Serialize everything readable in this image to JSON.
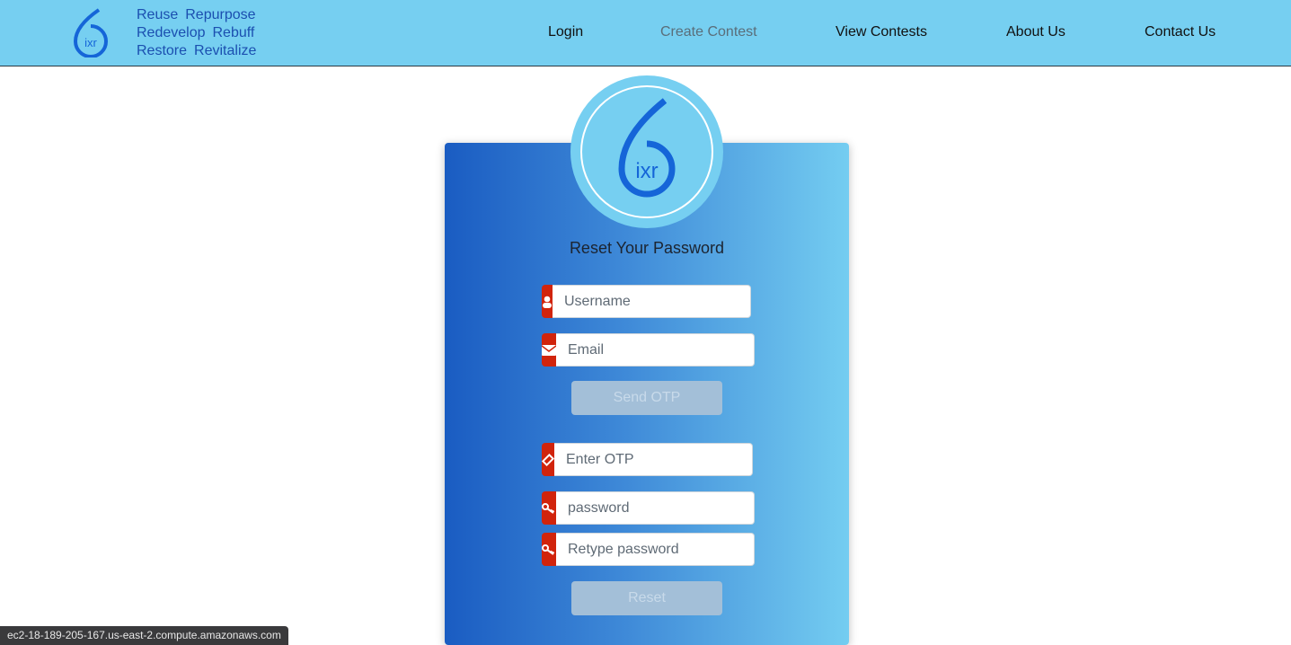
{
  "nav": {
    "taglines": [
      [
        "Reuse",
        "Repurpose"
      ],
      [
        "Redevelop",
        "Rebuff"
      ],
      [
        "Restore",
        "Revitalize"
      ]
    ],
    "links": [
      "Login",
      "Create Contest",
      "View Contests",
      "About Us",
      "Contact Us"
    ],
    "logo_text": "ixr"
  },
  "form": {
    "title": "Reset Your Password",
    "badge_text": "ixr",
    "username_placeholder": "Username",
    "email_placeholder": "Email",
    "send_otp": "Send OTP",
    "otp_placeholder": "Enter OTP",
    "password_placeholder": "password",
    "retype_placeholder": "Retype password",
    "reset": "Reset"
  },
  "status_url": "ec2-18-189-205-167.us-east-2.compute.amazonaws.com",
  "colors": {
    "nav": "#76cff1",
    "accent": "#d1240c",
    "brand": "#1b4fb0"
  }
}
